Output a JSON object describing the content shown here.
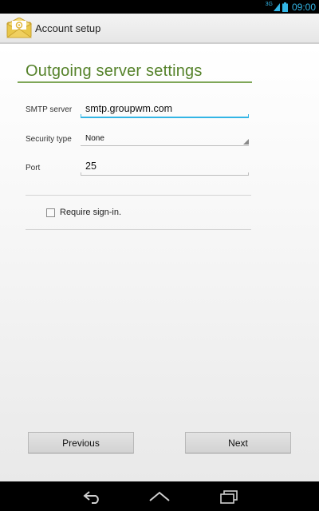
{
  "status_bar": {
    "network": "3G",
    "time": "09:00"
  },
  "action_bar": {
    "title": "Account setup",
    "icon": "email-app-icon"
  },
  "page": {
    "title": "Outgoing server settings"
  },
  "form": {
    "smtp_label": "SMTP server",
    "smtp_value": "smtp.groupwm.com",
    "security_label": "Security type",
    "security_value": "None",
    "port_label": "Port",
    "port_value": "25",
    "require_signin_label": "Require sign-in.",
    "require_signin_checked": false
  },
  "buttons": {
    "previous": "Previous",
    "next": "Next"
  },
  "nav": {
    "icons": [
      "back-icon",
      "home-icon",
      "recent-apps-icon"
    ]
  },
  "colors": {
    "accent": "#33b5e5",
    "title_green": "#55822a"
  }
}
